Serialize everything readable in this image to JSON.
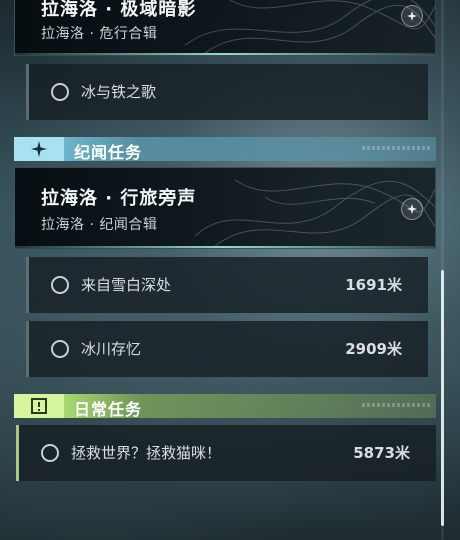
{
  "top_card": {
    "title": "拉海洛 · 极域暗影",
    "subtitle": "拉海洛 · 危行合辑"
  },
  "top_tasks": [
    {
      "name": "冰与铁之歌",
      "distance": ""
    }
  ],
  "section_story": {
    "title": "纪闻任务",
    "icon": "four-point-star-icon",
    "color": "#8fd3e8"
  },
  "story_card": {
    "title": "拉海洛 · 行旅旁声",
    "subtitle": "拉海洛 · 纪闻合辑"
  },
  "story_tasks": [
    {
      "name": "来自雪白深处",
      "distance": "1691米"
    },
    {
      "name": "冰川存忆",
      "distance": "2909米"
    }
  ],
  "section_daily": {
    "title": "日常任务",
    "icon": "alert-box-icon",
    "color": "#c8f08a"
  },
  "daily_tasks": [
    {
      "name": "拯救世界？拯救猫咪！",
      "distance": "5873米"
    }
  ]
}
